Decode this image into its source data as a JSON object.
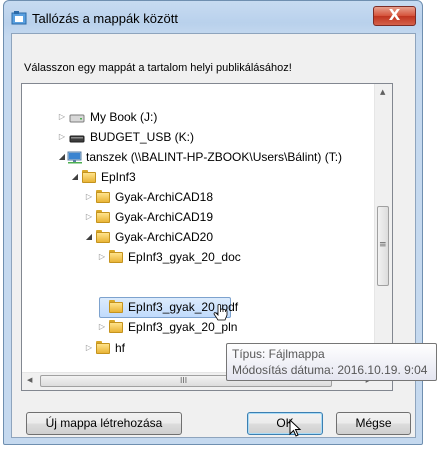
{
  "window": {
    "title": "Tallózás a mappák között",
    "close_glyph": "X",
    "instruction": "Válasszon egy mappát a tartalom helyi publikálásához!"
  },
  "tree": {
    "items": [
      {
        "label": "My Book (J:)",
        "icon": "drive-icon",
        "state": "collapsed"
      },
      {
        "label": "BUDGET_USB (K:)",
        "icon": "usb-drive-icon",
        "state": "collapsed"
      },
      {
        "label": "tanszek (\\\\BALINT-HP-ZBOOK\\Users\\Bálint) (T:)",
        "icon": "network-drive-icon",
        "state": "expanded"
      },
      {
        "label": "EpInf3",
        "icon": "folder-icon",
        "state": "expanded"
      },
      {
        "label": "Gyak-ArchiCAD18",
        "icon": "folder-icon",
        "state": "collapsed"
      },
      {
        "label": "Gyak-ArchiCAD19",
        "icon": "folder-icon",
        "state": "collapsed"
      },
      {
        "label": "Gyak-ArchiCAD20",
        "icon": "folder-icon",
        "state": "expanded"
      },
      {
        "label": "EpInf3_gyak_20_doc",
        "icon": "folder-icon",
        "state": "collapsed"
      },
      {
        "label": "EpInf3_gyak_20_pdf",
        "icon": "folder-icon",
        "state": "selected"
      },
      {
        "label": "EpInf3_gyak_20_pln",
        "icon": "folder-icon",
        "state": "collapsed"
      },
      {
        "label": "hf",
        "icon": "folder-icon",
        "state": "collapsed"
      }
    ],
    "tooltip": {
      "line1": "Típus: Fájlmappa",
      "line2": "Módosítás dátuma: 2016.10.19. 9:04"
    },
    "scroll_arrows": {
      "up": "▲",
      "down": "▼",
      "left": "◀",
      "right": "▶"
    },
    "collapsed_glyph": "▷",
    "expanded_glyph": "◢",
    "hscroll_grip": "III",
    "vscroll_grip": "≡"
  },
  "buttons": {
    "new_folder": "Új mappa létrehozása",
    "ok": "OK",
    "cancel": "Mégse"
  },
  "colors": {
    "accent": "#3c7fb1",
    "selection": "#c1dbfc",
    "close_button": "#c0341f"
  }
}
